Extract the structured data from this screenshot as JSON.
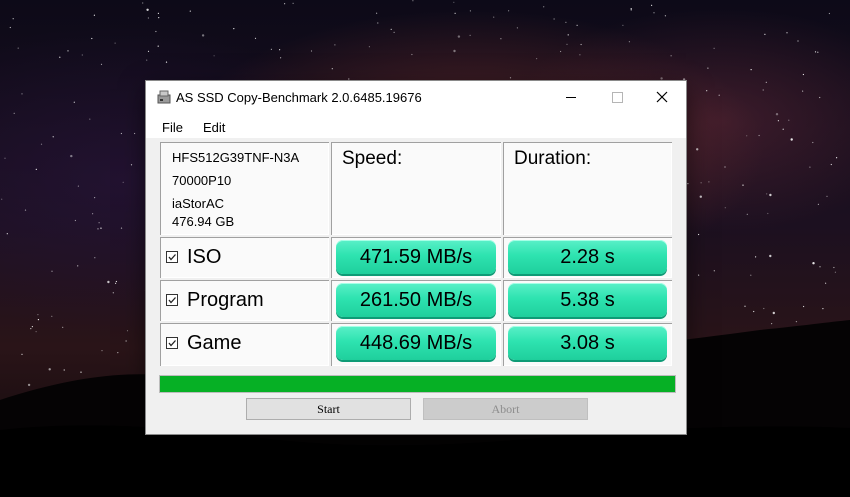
{
  "window": {
    "title": "AS SSD Copy-Benchmark 2.0.6485.19676",
    "icon": "drive-icon"
  },
  "menu": {
    "items": [
      "File",
      "Edit"
    ]
  },
  "drive": {
    "model": "HFS512G39TNF-N3A",
    "firmware": "70000P10",
    "driver": "iaStorAC",
    "capacity": "476.94 GB"
  },
  "columns": {
    "speed": "Speed:",
    "duration": "Duration:"
  },
  "rows": [
    {
      "label": "ISO",
      "checked": true,
      "speed": "471.59 MB/s",
      "duration": "2.28 s"
    },
    {
      "label": "Program",
      "checked": true,
      "speed": "261.50 MB/s",
      "duration": "5.38 s"
    },
    {
      "label": "Game",
      "checked": true,
      "speed": "448.69 MB/s",
      "duration": "3.08 s"
    }
  ],
  "progress": {
    "percent": 100,
    "color": "#06b025"
  },
  "buttons": {
    "start": "Start",
    "abort": "Abort"
  },
  "colors": {
    "result_fill": "#2ee3b0"
  }
}
